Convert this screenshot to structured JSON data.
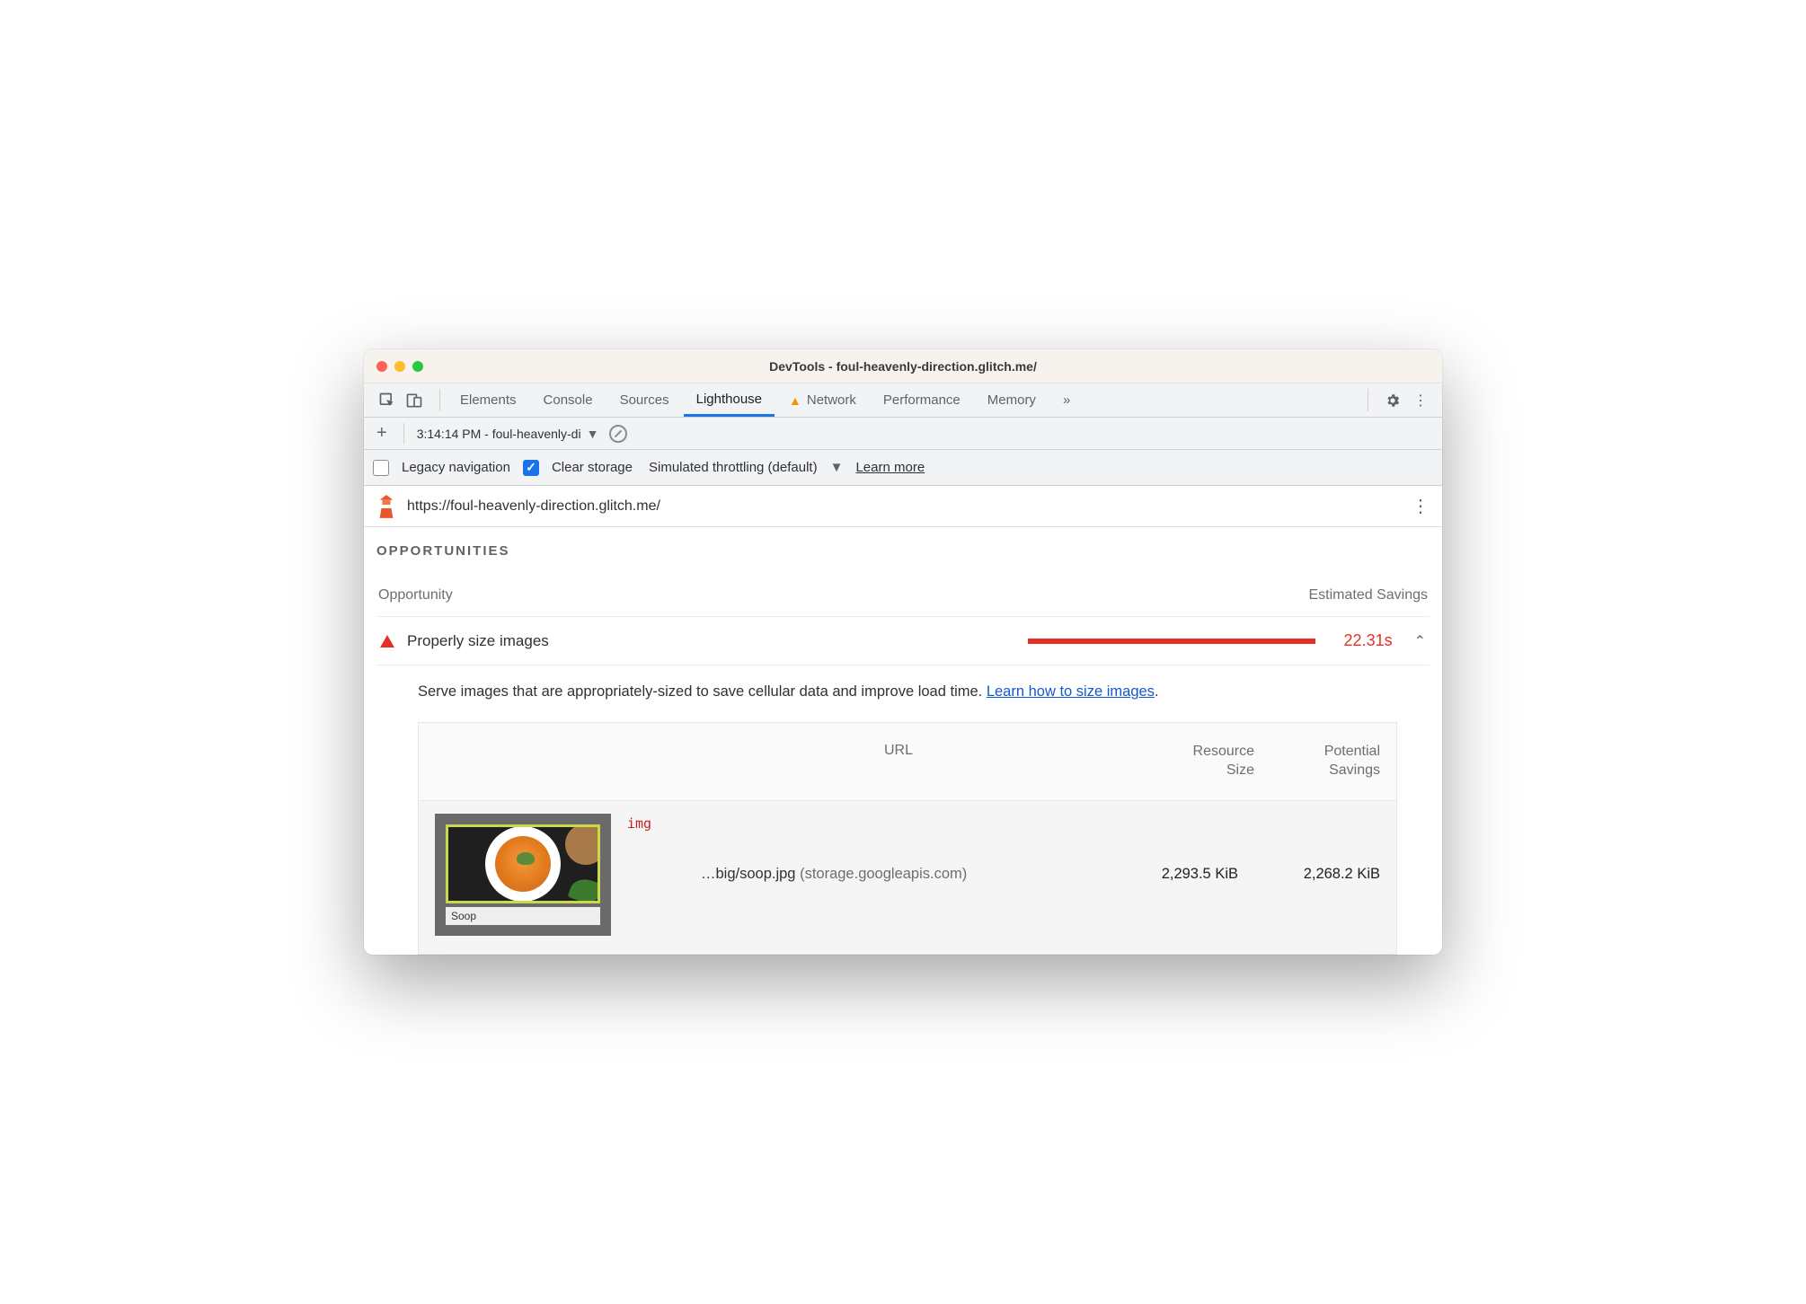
{
  "window": {
    "title": "DevTools - foul-heavenly-direction.glitch.me/"
  },
  "tabs": [
    "Elements",
    "Console",
    "Sources",
    "Lighthouse",
    "Network",
    "Performance",
    "Memory"
  ],
  "tabs_active_index": 3,
  "tabs_warn_index": 4,
  "tabs_more_glyph": "»",
  "toolbar": {
    "plus": "+",
    "run_label": "3:14:14 PM - foul-heavenly-di",
    "caret": "▼"
  },
  "options": {
    "legacy": {
      "label": "Legacy navigation",
      "checked": false
    },
    "clear": {
      "label": "Clear storage",
      "checked": true
    },
    "throttle_label": "Simulated throttling (default)",
    "caret": "▼",
    "learn_more": "Learn more"
  },
  "url": "https://foul-heavenly-direction.glitch.me/",
  "section": "OPPORTUNITIES",
  "columns": {
    "left": "Opportunity",
    "right": "Estimated Savings"
  },
  "opportunity": {
    "title": "Properly size images",
    "savings": "22.31s",
    "chevron": "⌃",
    "description_prefix": "Serve images that are appropriately-sized to save cellular data and improve load time. ",
    "description_link": "Learn how to size images",
    "period": "."
  },
  "table": {
    "headers": {
      "url": "URL",
      "resource_l1": "Resource",
      "resource_l2": "Size",
      "potential_l1": "Potential",
      "potential_l2": "Savings"
    },
    "row": {
      "thumb_label": "Soop",
      "tag": "img",
      "url_short": "…big/soop.jpg",
      "host": " (storage.googleapis.com)",
      "resource_size": "2,293.5 KiB",
      "potential_savings": "2,268.2 KiB"
    }
  }
}
